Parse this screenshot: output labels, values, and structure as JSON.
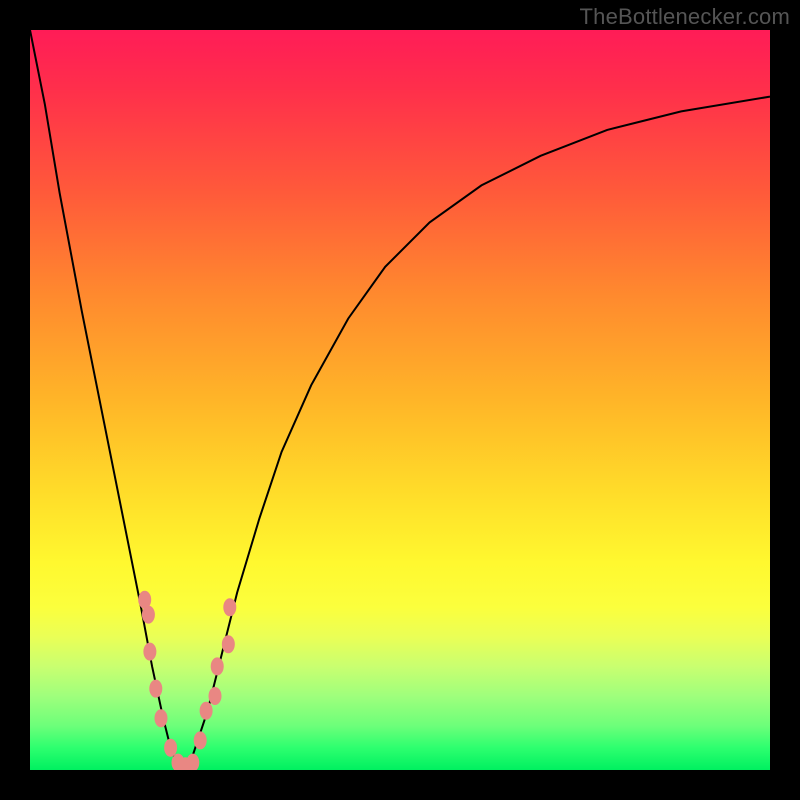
{
  "watermark": {
    "text": "TheBottlenecker.com"
  },
  "colors": {
    "frame": "#000000",
    "curve_stroke": "#000000",
    "marker_fill": "#e98783",
    "gradient_top": "#ff1c57",
    "gradient_bottom": "#00f060"
  },
  "chart_data": {
    "type": "line",
    "title": "",
    "xlabel": "",
    "ylabel": "",
    "x_range": [
      0,
      100
    ],
    "y_range": [
      0,
      100
    ],
    "grid": false,
    "legend": false,
    "series": [
      {
        "name": "bottleneck-curve",
        "x": [
          0,
          2,
          4,
          7,
          10,
          13,
          15,
          16.5,
          18,
          19,
          20,
          21,
          22,
          24,
          26,
          28,
          31,
          34,
          38,
          43,
          48,
          54,
          61,
          69,
          78,
          88,
          100
        ],
        "y": [
          100,
          90,
          78,
          62,
          47,
          32,
          22,
          14,
          7,
          3,
          0.5,
          0,
          2,
          8,
          16,
          24,
          34,
          43,
          52,
          61,
          68,
          74,
          79,
          83,
          86.5,
          89,
          91
        ]
      }
    ],
    "markers": [
      {
        "x": 15.5,
        "y": 23
      },
      {
        "x": 16.0,
        "y": 21
      },
      {
        "x": 16.2,
        "y": 16
      },
      {
        "x": 17.0,
        "y": 11
      },
      {
        "x": 17.7,
        "y": 7
      },
      {
        "x": 19.0,
        "y": 3
      },
      {
        "x": 20.0,
        "y": 1
      },
      {
        "x": 21.0,
        "y": 0.5
      },
      {
        "x": 22.0,
        "y": 1
      },
      {
        "x": 23.0,
        "y": 4
      },
      {
        "x": 23.8,
        "y": 8
      },
      {
        "x": 25.0,
        "y": 10
      },
      {
        "x": 25.3,
        "y": 14
      },
      {
        "x": 26.8,
        "y": 17
      },
      {
        "x": 27.0,
        "y": 22
      }
    ]
  }
}
